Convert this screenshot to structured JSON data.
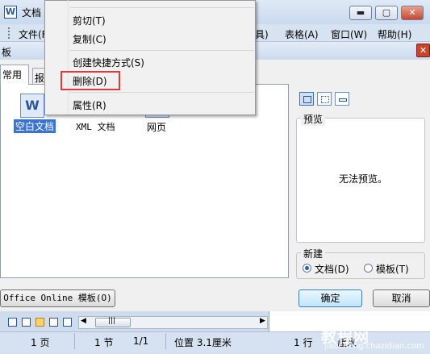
{
  "window": {
    "icon_text": "W",
    "title": "文档",
    "controls": {
      "minimize": "▬",
      "maximize": "▢",
      "close": "✕"
    }
  },
  "menubar": {
    "items": [
      "文件(F",
      "具)",
      "表格(A)",
      "窗口(W)",
      "帮助(H)"
    ]
  },
  "dialog": {
    "title_fragment": "板",
    "close": "✕",
    "tabs": [
      "常用",
      "报"
    ],
    "templates": [
      {
        "label": "空白文档",
        "icon_text": "W",
        "selected": true
      },
      {
        "label": "XML 文档",
        "selected": false
      },
      {
        "label": "网页",
        "selected": false
      }
    ],
    "preview": {
      "legend": "预览",
      "empty_text": "无法预览。"
    },
    "new_group": {
      "legend": "新建",
      "options": [
        {
          "label": "文档(D)",
          "checked": true
        },
        {
          "label": "模板(T)",
          "checked": false
        }
      ]
    },
    "buttons": {
      "online": "Office Online 模板(O)",
      "ok": "确定",
      "cancel": "取消"
    }
  },
  "context_menu": {
    "items": [
      {
        "label": "剪切(T)"
      },
      {
        "label": "复制(C)"
      },
      {
        "label": "创建快捷方式(S)"
      },
      {
        "label": "删除(D)",
        "highlighted": true
      },
      {
        "label": "属性(R)"
      }
    ],
    "highlight_color": "#e03a3a"
  },
  "statusbar": {
    "page": "1 页",
    "section": "1 节",
    "page_of": "1/1",
    "position": "位置 3.1厘米",
    "line": "1 行",
    "column_fragment": "厘米"
  },
  "scrollbar": {
    "left": "◀",
    "right": "▶",
    "thumb": "|||"
  },
  "watermark": {
    "main": "教程网",
    "url": "jiaocheng.chazidian.com"
  }
}
